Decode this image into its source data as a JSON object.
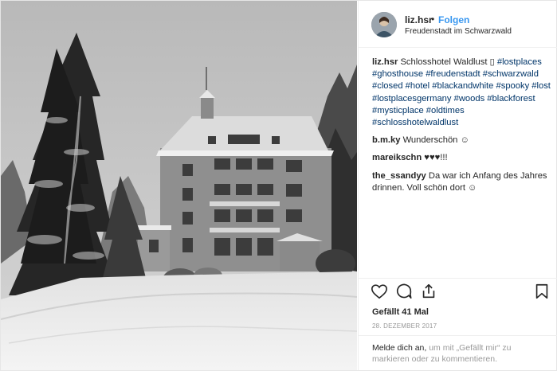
{
  "header": {
    "username": "liz.hsr",
    "separator": "•",
    "follow_label": "Folgen",
    "location": "Freudenstadt im Schwarzwald"
  },
  "caption": {
    "username": "liz.hsr",
    "text": "Schlosshotel Waldlust ▯",
    "hashtags": [
      "#lostplaces",
      "#ghosthouse",
      "#freudenstadt",
      "#schwarzwald",
      "#closed",
      "#hotel",
      "#blackandwhite",
      "#spooky",
      "#lost",
      "#lostplacesgermany",
      "#woods",
      "#blackforest",
      "#mysticplace",
      "#oldtimes",
      "#schlosshotelwaldlust"
    ]
  },
  "comments": [
    {
      "username": "b.m.ky",
      "text": "Wunderschön ☺"
    },
    {
      "username": "mareikschn",
      "text": "♥♥♥!!!"
    },
    {
      "username": "the_ssandyy",
      "text": "Da war ich Anfang des Jahres drinnen. Voll schön dort ☺"
    }
  ],
  "actions": {
    "icons": [
      "heart-icon",
      "comment-icon",
      "share-icon",
      "bookmark-icon"
    ]
  },
  "likes": "Gefällt 41 Mal",
  "date": "28. DEZEMBER 2017",
  "login_prompt": {
    "link": "Melde dich an,",
    "text": " um mit „Gefällt mir“ zu markieren oder zu kommentieren."
  },
  "colors": {
    "link_blue": "#3897f0",
    "hashtag": "#003569",
    "muted": "#999999",
    "border": "#efefef"
  }
}
